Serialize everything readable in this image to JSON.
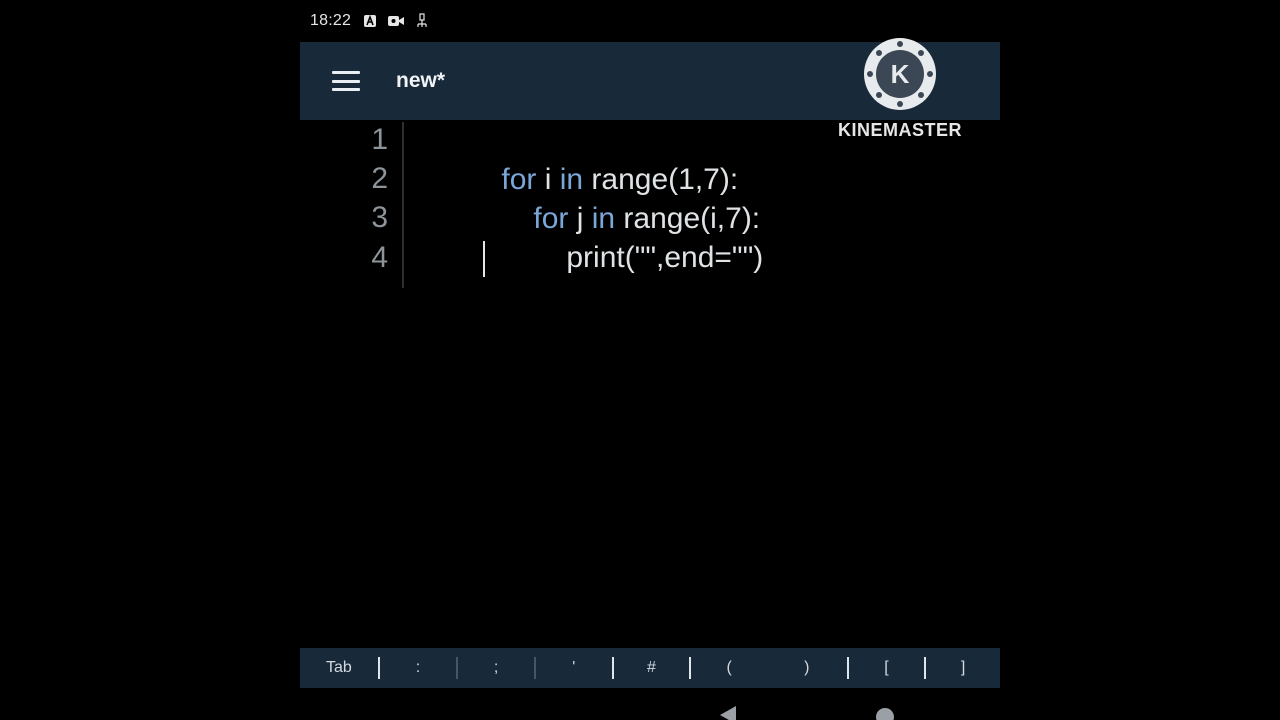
{
  "status_bar": {
    "time": "18:22",
    "icons": [
      "notification-a-icon",
      "video-camera-icon",
      "usb-debug-icon"
    ]
  },
  "app_bar": {
    "menu_icon": "hamburger-menu-icon",
    "title": "new*"
  },
  "editor": {
    "lines": [
      {
        "number": "1",
        "tokens": [
          {
            "t": "for",
            "k": "kw"
          },
          {
            "t": " i ",
            "k": "plain"
          },
          {
            "t": "in",
            "k": "kw"
          },
          {
            "t": " range(1,7):",
            "k": "plain"
          }
        ]
      },
      {
        "number": "2",
        "tokens": [
          {
            "t": "for",
            "k": "kw"
          },
          {
            "t": " j ",
            "k": "plain"
          },
          {
            "t": "in",
            "k": "kw"
          },
          {
            "t": " range(i,7):",
            "k": "plain"
          }
        ]
      },
      {
        "number": "3",
        "tokens": [
          {
            "t": "print(\"\",end=\"\")",
            "k": "plain"
          }
        ]
      },
      {
        "number": "4",
        "tokens": []
      }
    ],
    "keyword_color": "#7aa7d8",
    "text_color": "#dfe3e6"
  },
  "symbol_bar": {
    "keys": [
      "Tab",
      ":",
      ";",
      "'",
      "#",
      "(",
      ")",
      "[",
      "]"
    ]
  },
  "watermark": {
    "letter": "K",
    "text": "KINEMASTER"
  }
}
